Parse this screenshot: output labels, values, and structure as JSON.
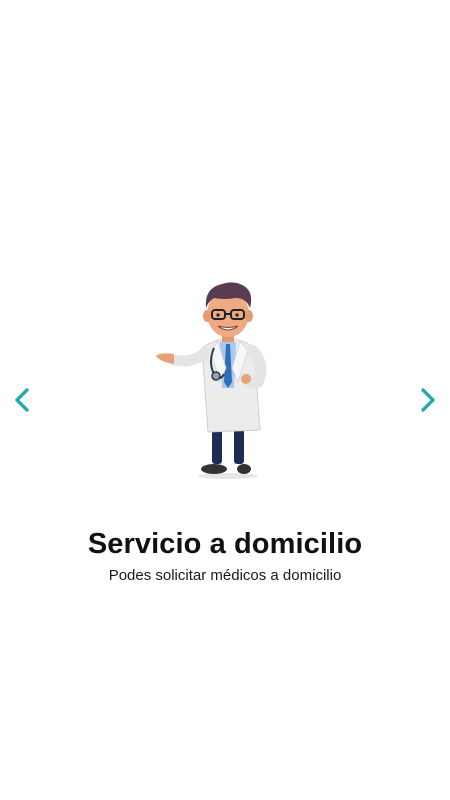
{
  "onboarding": {
    "slide": {
      "title": "Servicio a domicilio",
      "subtitle": "Podes solicitar médicos a domicilio",
      "illustration": "doctor-illustration"
    },
    "navigation": {
      "prev_icon": "chevron-left-icon",
      "next_icon": "chevron-right-icon",
      "arrow_color": "#2ea6ad"
    }
  }
}
